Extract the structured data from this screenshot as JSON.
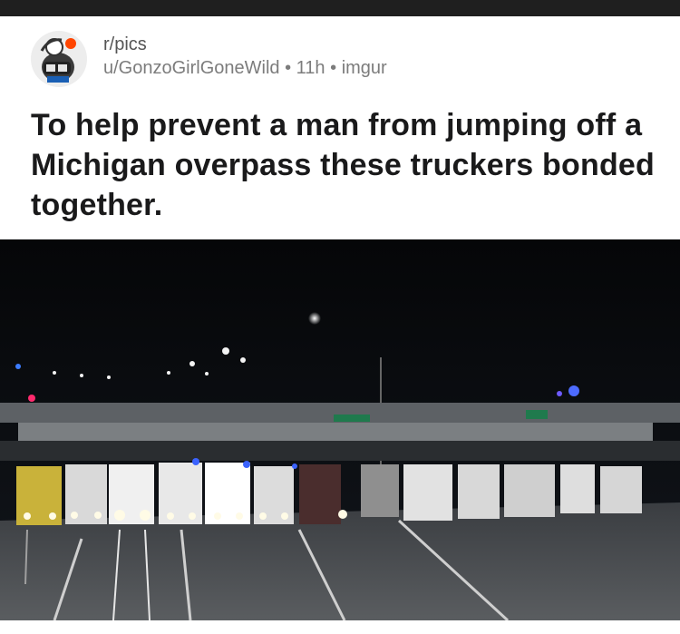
{
  "post": {
    "subreddit": "r/pics",
    "author": "u/GonzoGirlGoneWild",
    "time": "11h",
    "domain": "imgur",
    "separator": "•",
    "title": "To help prevent a man from jumping off a Michigan overpass these truckers bonded together."
  },
  "icons": {
    "avatar": "snoo-avatar-icon"
  },
  "colors": {
    "top_bar": "#1f1f1f",
    "meta_text": "#7c7c7c",
    "title_text": "#1a1a1b"
  }
}
